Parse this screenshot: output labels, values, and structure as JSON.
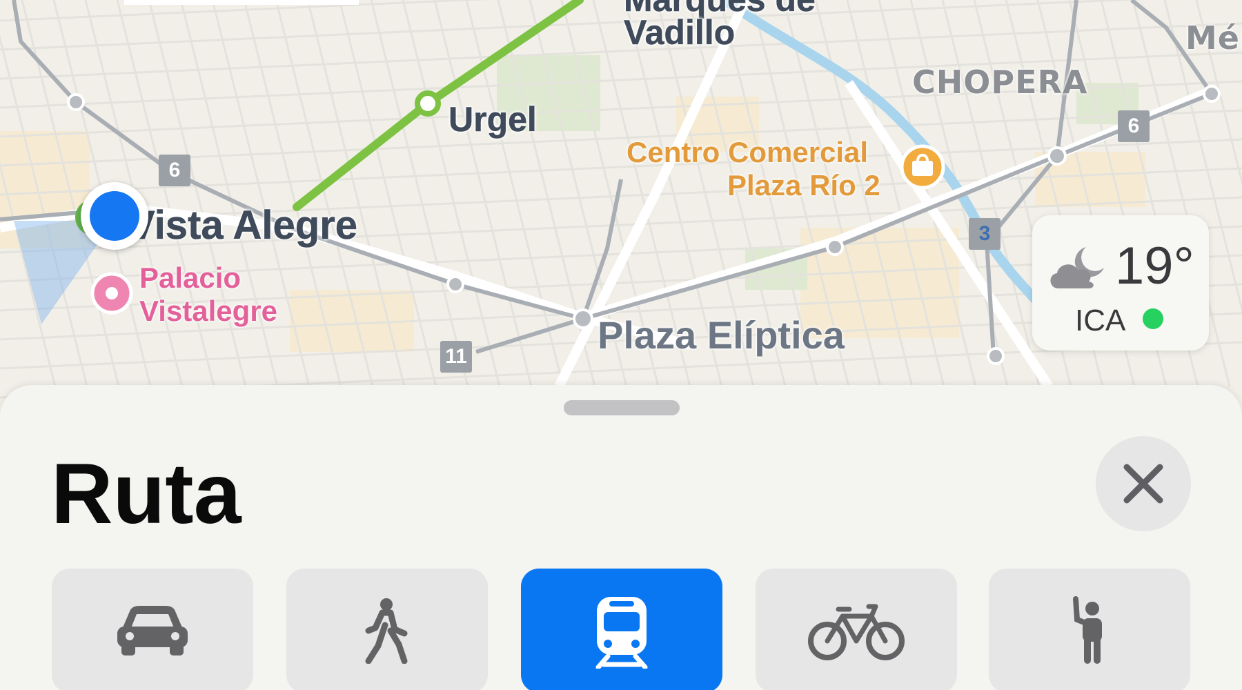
{
  "map": {
    "stations": {
      "marques": "Marqués de",
      "vadillo": "Vadillo",
      "urgel": "Urgel",
      "vista_alegre": "Vista Alegre",
      "plaza_eliptica": "Plaza Elíptica"
    },
    "districts": {
      "chopera": "CHOPERA",
      "mendez": "Mén"
    },
    "pois": {
      "centro_line1": "Centro Comercial",
      "centro_line2": "Plaza Río 2",
      "palacio_line1": "Palacio",
      "palacio_line2": "Vistalegre"
    },
    "line_badges": {
      "badge_6_left": "6",
      "badge_6_right": "6",
      "badge_3": "3",
      "badge_11": "11"
    },
    "icons": {
      "shopping": "shopping-bag-icon",
      "palacio": "pin-icon",
      "user_location": "location-dot"
    },
    "colors": {
      "metro_line": "#7dc242",
      "user_dot": "#1677f2",
      "river": "#a8d4ee"
    }
  },
  "weather": {
    "temperature": "19°",
    "air_quality_label": "ICA",
    "air_quality_color": "#27d15f",
    "icon": "cloud-moon-icon"
  },
  "sheet": {
    "title": "Ruta",
    "close_icon": "close-icon",
    "selected_mode": "transit",
    "modes": [
      {
        "id": "car",
        "icon": "car-icon"
      },
      {
        "id": "walk",
        "icon": "walking-icon"
      },
      {
        "id": "transit",
        "icon": "train-icon"
      },
      {
        "id": "bike",
        "icon": "bicycle-icon"
      },
      {
        "id": "rideshare",
        "icon": "hail-icon"
      }
    ],
    "accent_color": "#0a77f2"
  }
}
